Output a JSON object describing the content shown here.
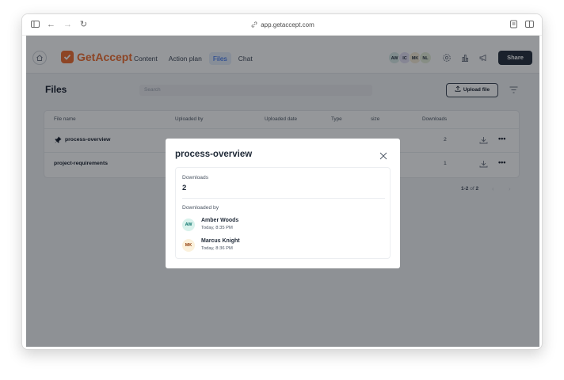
{
  "browser": {
    "url": "app.getaccept.com"
  },
  "nav": {
    "logo_text": "GetAccept",
    "tabs": [
      {
        "label": "Content"
      },
      {
        "label": "Action plan"
      },
      {
        "label": "Files",
        "active": true
      },
      {
        "label": "Chat"
      }
    ],
    "avatars": [
      {
        "initials": "AW",
        "color": "#d9ece8"
      },
      {
        "initials": "IC",
        "color": "#e4e0f5"
      },
      {
        "initials": "MK",
        "color": "#f6ecd6"
      },
      {
        "initials": "NL",
        "color": "#e6efd9"
      }
    ],
    "share_label": "Share",
    "icons": [
      "home-icon",
      "gear-icon",
      "chart-icon",
      "megaphone-icon"
    ]
  },
  "page": {
    "title": "Files",
    "search_placeholder": "Search",
    "upload_label": "Upload file"
  },
  "table": {
    "columns": [
      "File name",
      "Uploaded by",
      "Uploaded date",
      "Type",
      "size",
      "Downloads"
    ],
    "rows": [
      {
        "name": "process-overview",
        "pinned": true,
        "downloads": "2"
      },
      {
        "name": "project-requirements",
        "pinned": false,
        "downloads": "1"
      }
    ]
  },
  "pager": {
    "range": "1-2",
    "of_label": "of",
    "total": "2"
  },
  "modal": {
    "title": "process-overview",
    "downloads_label": "Downloads",
    "downloads_value": "2",
    "downloaded_by_label": "Downloaded by",
    "users": [
      {
        "initials": "AW",
        "name": "Amber Woods",
        "time": "Today, 8:35 PM",
        "color": "#d9f2ec",
        "text_color": "#0f766e"
      },
      {
        "initials": "MK",
        "name": "Marcus Knight",
        "time": "Today, 8:36 PM",
        "color": "#fbf1dc",
        "text_color": "#92400e"
      }
    ]
  }
}
